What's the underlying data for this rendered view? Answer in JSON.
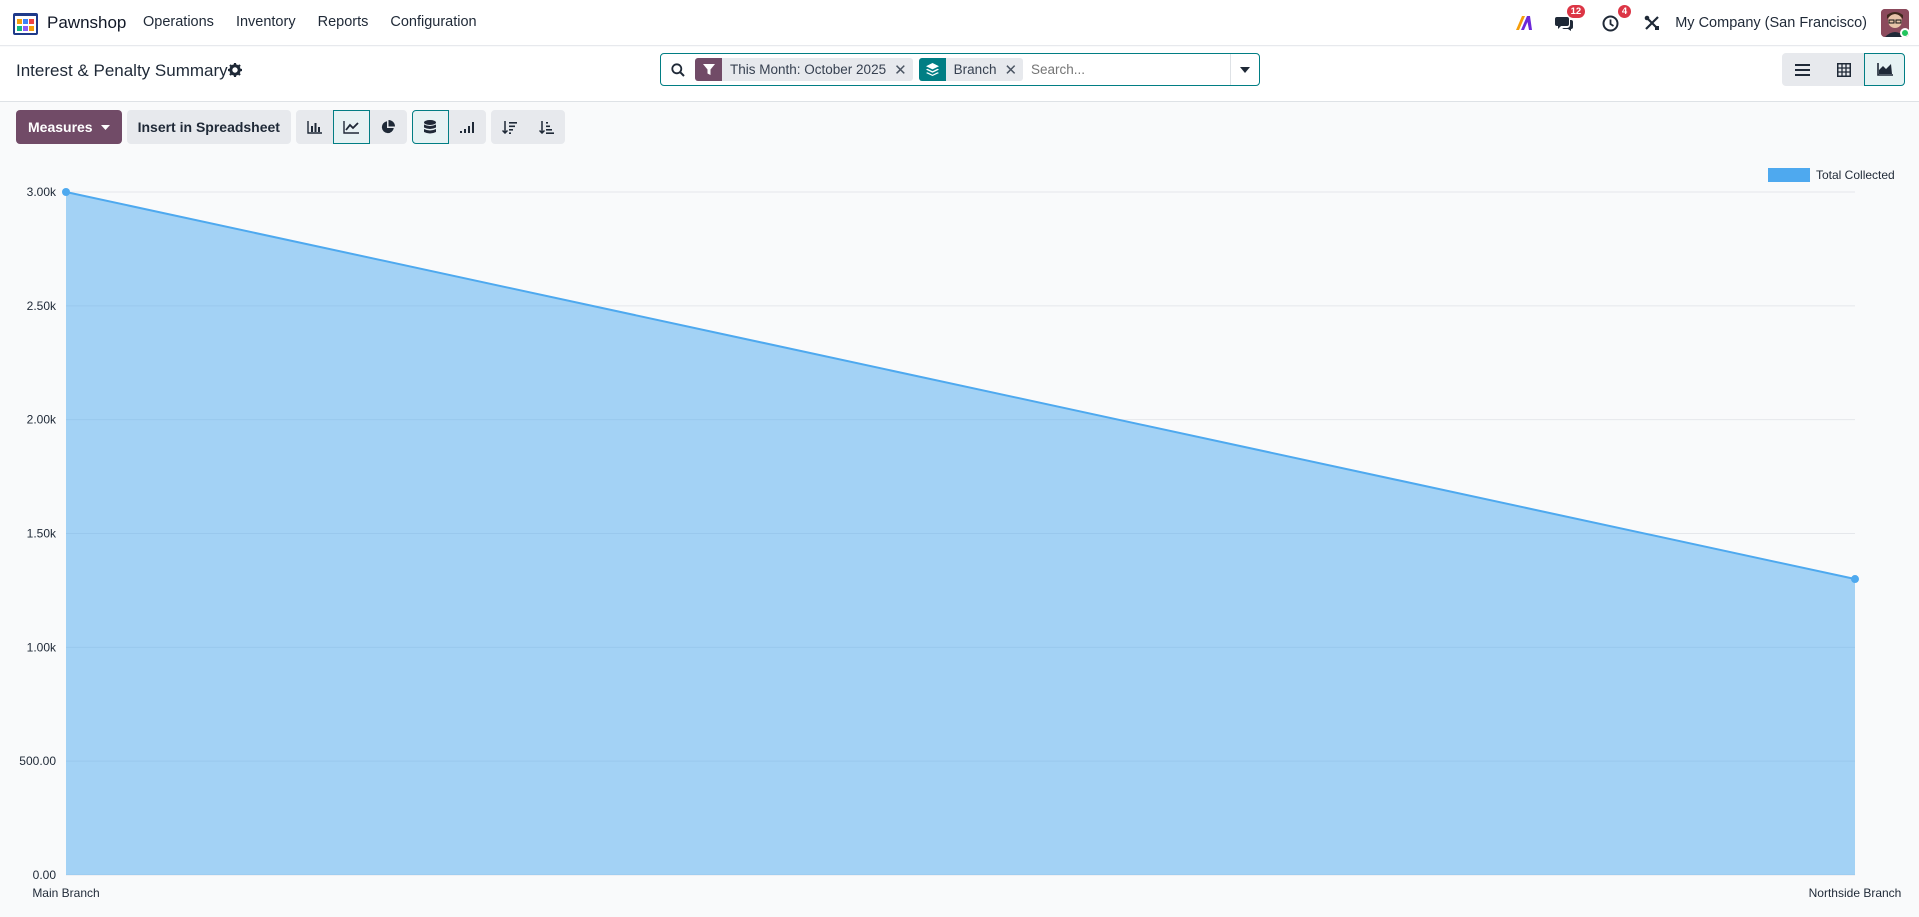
{
  "app": {
    "name": "Pawnshop"
  },
  "menu": [
    "Operations",
    "Inventory",
    "Reports",
    "Configuration"
  ],
  "navbar": {
    "messages_count": "12",
    "activities_count": "4",
    "company": "My Company (San Francisco)"
  },
  "page": {
    "title": "Interest & Penalty Summary"
  },
  "search": {
    "facets": [
      {
        "label": "This Month: October 2025",
        "icon": "filter-icon",
        "color": "#714b67"
      },
      {
        "label": "Branch",
        "icon": "group-layers-icon",
        "color": "#017e84"
      }
    ],
    "placeholder": "Search..."
  },
  "toolbar": {
    "measures_label": "Measures",
    "insert_label": "Insert in Spreadsheet"
  },
  "colors": {
    "brand": "#714b67",
    "accent": "#017e84",
    "series": "#4ea9ef"
  },
  "chart_data": {
    "type": "area",
    "categories": [
      "Main Branch",
      "Northside Branch"
    ],
    "series": [
      {
        "name": "Total Collected",
        "values": [
          3000,
          1300
        ]
      }
    ],
    "yticks": [
      "0.00",
      "500.00",
      "1.00k",
      "1.50k",
      "2.00k",
      "2.50k",
      "3.00k"
    ],
    "ylim": [
      0,
      3000
    ],
    "grid": true,
    "legend": "top-right"
  }
}
